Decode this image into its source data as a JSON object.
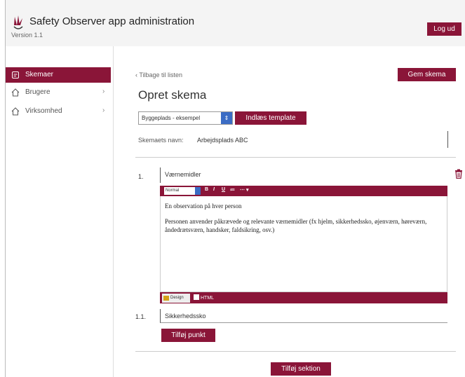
{
  "header": {
    "title": "Safety Observer app administration",
    "version": "Version 1.1",
    "logout_label": "Log ud",
    "logo_icon": "safety-observer-logo-icon"
  },
  "colors": {
    "accent": "#8a1538",
    "select_accent": "#3b6cc4"
  },
  "sidebar": {
    "items": [
      {
        "label": "Skemaer",
        "icon": "form-icon",
        "active": true
      },
      {
        "label": "Brugere",
        "icon": "home-icon",
        "chevron": "›"
      },
      {
        "label": "Virksomhed",
        "icon": "home-icon",
        "chevron": "›"
      }
    ]
  },
  "main": {
    "back_label": "‹ Tilbage til listen",
    "save_label": "Gem skema",
    "page_title": "Opret skema",
    "template_select": "Byggeplads - eksempel",
    "load_template_label": "Indlæs template",
    "name_label": "Skemaets navn:",
    "name_value": "Arbejdsplads ABC",
    "section": {
      "number": "1.",
      "title": "Værnemidler",
      "toolbar": {
        "format_select": "Normal",
        "bold": "B",
        "italic": "I",
        "underline": "U",
        "list": "≔",
        "more": "⋯ ▾"
      },
      "editor_paragraphs": [
        "En observation på hver person",
        "Personen anvender påkrævede og relevante værnemidler (fx hjelm, sikkerhedssko, øjenværn, høreværn, åndedrætsværn, handsker, faldsikring, osv.)"
      ],
      "editor_tab_edit": "Design",
      "editor_tab_html": "HTML"
    },
    "item": {
      "number": "1.1.",
      "value": "Sikkerhedssko"
    },
    "add_point_label": "Tilføj punkt",
    "add_section_label": "Tilføj sektion"
  }
}
